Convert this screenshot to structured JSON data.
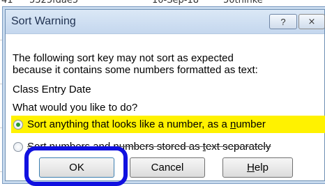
{
  "background_sheet": {
    "top_strip_text": [
      "41",
      "5325fdae5",
      "10-Sep-18",
      "50thinke"
    ]
  },
  "dialog": {
    "title": "Sort Warning",
    "help_button_label": "?",
    "close_button_label": "⨯",
    "message_line1": "The following sort key may not sort as expected",
    "message_line2": "because it contains some numbers formatted as text:",
    "field_name": "Class Entry Date",
    "question": "What would you like to do?",
    "option1": {
      "pre": "Sort anything that looks like a number, as a ",
      "underlined": "n",
      "post": "umber",
      "selected": true
    },
    "option2": {
      "pre": "Sort numbers and numbers stored as ",
      "underlined": "t",
      "post": "ext separately",
      "selected": false
    },
    "buttons": {
      "ok": "OK",
      "cancel": "Cancel",
      "help_underlined": "H",
      "help_rest": "elp"
    }
  },
  "colors": {
    "highlight": "#fff200",
    "annotation_circle": "#1010e0",
    "radio_selected": "#2e9d2e"
  }
}
